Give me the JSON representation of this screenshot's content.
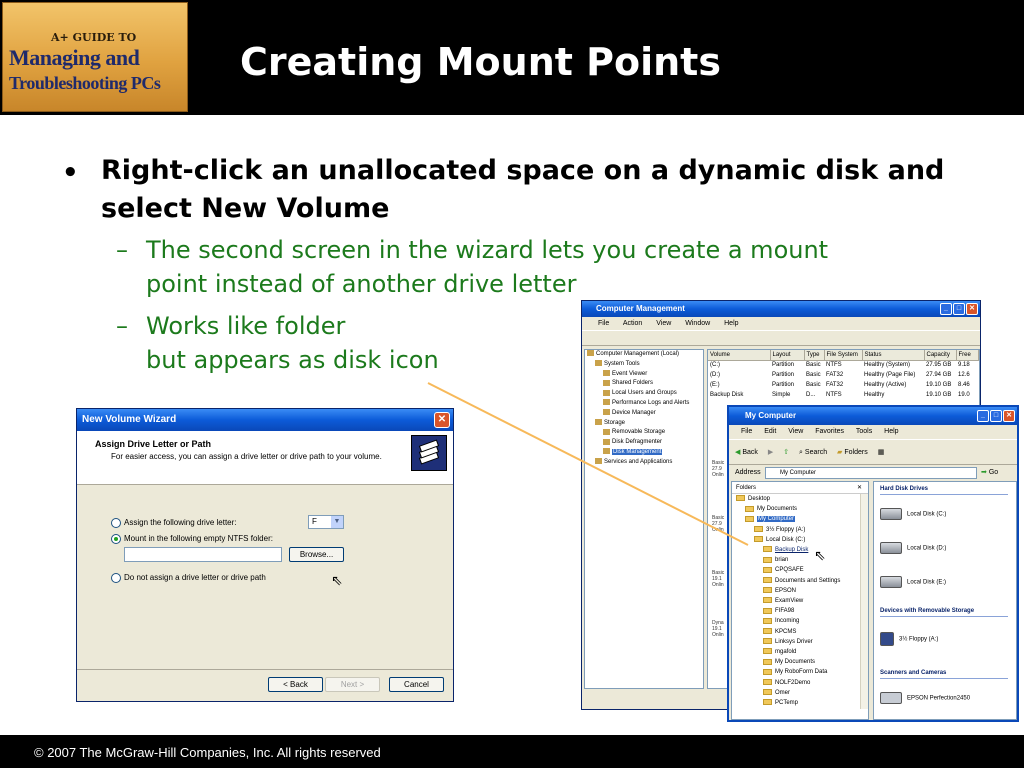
{
  "slide": {
    "logo": {
      "line1": "A+ GUIDE TO",
      "line2": "Managing and",
      "line3": "Troubleshooting PCs"
    },
    "title": "Creating Mount Points",
    "bullet_main": "Right-click an unallocated space on a dynamic disk and select New Volume",
    "sub_bullets": [
      {
        "text": "The second screen in the wizard lets you create a mount point instead of another drive letter"
      },
      {
        "line1": "Works like folder",
        "line2": "but appears as disk icon"
      }
    ],
    "footer": "© 2007 The McGraw-Hill Companies, Inc. All rights reserved"
  },
  "wizard": {
    "title": "New Volume Wizard",
    "heading": "Assign Drive Letter or Path",
    "subheading": "For easier access, you can assign a drive letter or drive path to your volume.",
    "options": [
      {
        "label": "Assign the following drive letter:",
        "selected": false
      },
      {
        "label": "Mount in the following empty NTFS folder:",
        "selected": true
      },
      {
        "label": "Do not assign a drive letter or drive path",
        "selected": false
      }
    ],
    "drive_letter": "F",
    "path_value": "",
    "browse_label": "Browse...",
    "back_label": "< Back",
    "next_label": "Next >",
    "cancel_label": "Cancel"
  },
  "computer_management": {
    "title": "Computer Management",
    "menu": [
      "File",
      "Action",
      "View",
      "Window",
      "Help"
    ],
    "tree": [
      {
        "label": "Computer Management (Local)",
        "indent": 0
      },
      {
        "label": "System Tools",
        "indent": 1
      },
      {
        "label": "Event Viewer",
        "indent": 2
      },
      {
        "label": "Shared Folders",
        "indent": 2
      },
      {
        "label": "Local Users and Groups",
        "indent": 2
      },
      {
        "label": "Performance Logs and Alerts",
        "indent": 2
      },
      {
        "label": "Device Manager",
        "indent": 2
      },
      {
        "label": "Storage",
        "indent": 1
      },
      {
        "label": "Removable Storage",
        "indent": 2
      },
      {
        "label": "Disk Defragmenter",
        "indent": 2
      },
      {
        "label": "Disk Management",
        "indent": 2,
        "selected": true
      },
      {
        "label": "Services and Applications",
        "indent": 1
      }
    ],
    "columns": [
      "Volume",
      "Layout",
      "Type",
      "File System",
      "Status",
      "Capacity",
      "Free"
    ],
    "rows": [
      [
        "(C:)",
        "Partition",
        "Basic",
        "NTFS",
        "Healthy (System)",
        "27.95 GB",
        "9.18"
      ],
      [
        "(D:)",
        "Partition",
        "Basic",
        "FAT32",
        "Healthy (Page File)",
        "27.94 GB",
        "12.6"
      ],
      [
        "(E:)",
        "Partition",
        "Basic",
        "FAT32",
        "Healthy (Active)",
        "19.10 GB",
        "8.46"
      ],
      [
        "Backup Disk",
        "Simple",
        "D...",
        "NTFS",
        "Healthy",
        "19.10 GB",
        "19.0"
      ]
    ],
    "disk_labels": [
      {
        "l1": "Basic",
        "l2": "27.9",
        "l3": "Onlin"
      },
      {
        "l1": "Basic",
        "l2": "27.9",
        "l3": "Onlin"
      },
      {
        "l1": "Basic",
        "l2": "19.1",
        "l3": "Onlin"
      },
      {
        "l1": "Dyna",
        "l2": "19.1",
        "l3": "Onlin"
      }
    ]
  },
  "my_computer": {
    "title": "My Computer",
    "menu": [
      "File",
      "Edit",
      "View",
      "Favorites",
      "Tools",
      "Help"
    ],
    "back_label": "Back",
    "search_label": "Search",
    "folders_label": "Folders",
    "address_label": "Address",
    "address_value": "My Computer",
    "go_label": "Go",
    "folders_header": "Folders",
    "folder_tree": [
      {
        "label": "Desktop",
        "indent": 0
      },
      {
        "label": "My Documents",
        "indent": 1
      },
      {
        "label": "My Computer",
        "indent": 1,
        "highlight": true
      },
      {
        "label": "3½ Floppy (A:)",
        "indent": 2
      },
      {
        "label": "Local Disk (C:)",
        "indent": 2
      },
      {
        "label": "Backup Disk",
        "indent": 3,
        "link": true
      },
      {
        "label": "brian",
        "indent": 3
      },
      {
        "label": "CPQSAFE",
        "indent": 3
      },
      {
        "label": "Documents and Settings",
        "indent": 3
      },
      {
        "label": "EPSON",
        "indent": 3
      },
      {
        "label": "ExamView",
        "indent": 3
      },
      {
        "label": "FIFA98",
        "indent": 3
      },
      {
        "label": "Incoming",
        "indent": 3
      },
      {
        "label": "KPCMS",
        "indent": 3
      },
      {
        "label": "Linksys Driver",
        "indent": 3
      },
      {
        "label": "mgafold",
        "indent": 3
      },
      {
        "label": "My Documents",
        "indent": 3
      },
      {
        "label": "My RoboForm Data",
        "indent": 3
      },
      {
        "label": "NOLF2Demo",
        "indent": 3
      },
      {
        "label": "Omer",
        "indent": 3
      },
      {
        "label": "PCTemp",
        "indent": 3
      }
    ],
    "hard_disk_header": "Hard Disk Drives",
    "drives": [
      "Local Disk (C:)",
      "Local Disk (D:)",
      "Local Disk (E:)"
    ],
    "removable_header": "Devices with Removable Storage",
    "removable": [
      "3½ Floppy (A:)"
    ],
    "scanners_header": "Scanners and Cameras",
    "scanners": [
      "EPSON Perfection2450"
    ]
  }
}
